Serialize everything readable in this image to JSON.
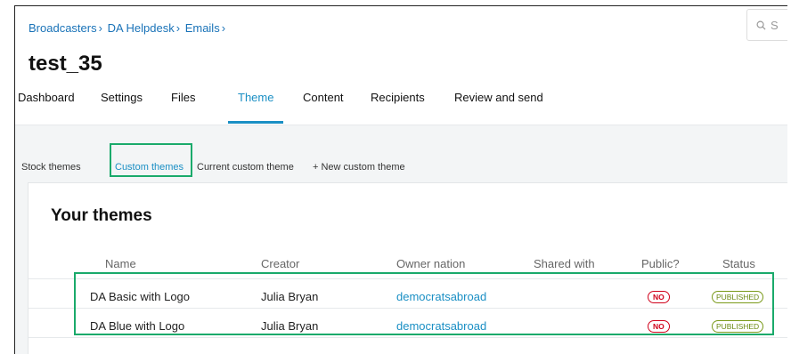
{
  "breadcrumb": [
    "Broadcasters",
    "DA Helpdesk",
    "Emails"
  ],
  "search": {
    "placeholder": "S"
  },
  "page_title": "test_35",
  "tabs": [
    "Dashboard",
    "Settings",
    "Files",
    "Theme",
    "Content",
    "Recipients",
    "Review and send"
  ],
  "active_tab": "Theme",
  "subtabs": [
    "Stock themes",
    "Custom themes",
    "Current custom theme",
    "+ New custom theme"
  ],
  "active_subtab": "Custom themes",
  "section_title": "Your themes",
  "table": {
    "headers": [
      "Name",
      "Creator",
      "Owner nation",
      "Shared with",
      "Public?",
      "Status"
    ],
    "rows": [
      {
        "name": "DA Basic with Logo",
        "creator": "Julia Bryan",
        "owner_nation": "democratsabroad",
        "shared_with": "",
        "public": "NO",
        "status": "PUBLISHED"
      },
      {
        "name": "DA Blue with Logo",
        "creator": "Julia Bryan",
        "owner_nation": "democratsabroad",
        "shared_with": "",
        "public": "NO",
        "status": "PUBLISHED"
      }
    ]
  },
  "colors": {
    "link": "#1a73b8",
    "accent": "#1a8fc4",
    "highlight": "#1aaa6b",
    "no_badge": "#d0021b",
    "published_badge": "#6b8a12"
  }
}
